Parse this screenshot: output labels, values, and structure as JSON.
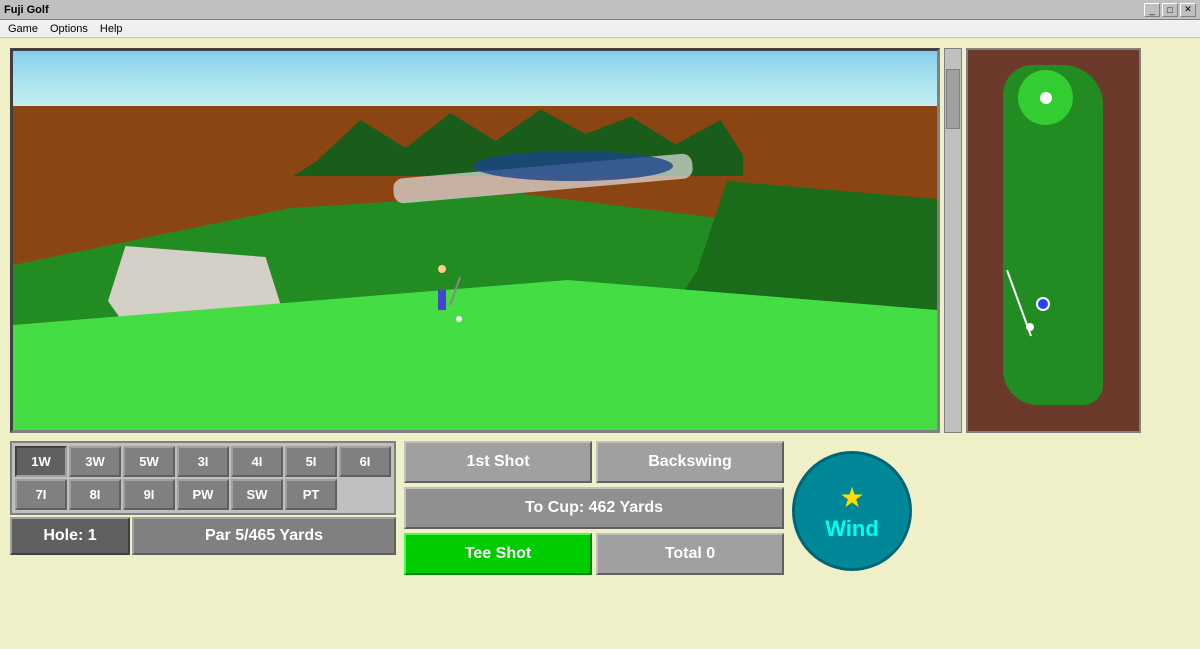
{
  "titleBar": {
    "title": "Fuji Golf",
    "minBtn": "_",
    "maxBtn": "□",
    "closeBtn": "✕"
  },
  "menuBar": {
    "items": [
      "Game",
      "Options",
      "Help"
    ]
  },
  "clubs": {
    "row1": [
      "1W",
      "3W",
      "5W",
      "3I",
      "4I",
      "5I",
      "6I"
    ],
    "row2": [
      "7I",
      "8I",
      "9I",
      "PW",
      "SW",
      "PT",
      ""
    ],
    "active": "1W"
  },
  "holeInfo": {
    "hole": "Hole: 1",
    "par": "Par 5/465 Yards"
  },
  "shotControls": {
    "firstShot": "1st Shot",
    "backswing": "Backswing",
    "distance": "To Cup: 462 Yards",
    "teeShot": "Tee Shot",
    "total": "Total 0"
  },
  "wind": {
    "label": "Wind",
    "star": "★"
  }
}
